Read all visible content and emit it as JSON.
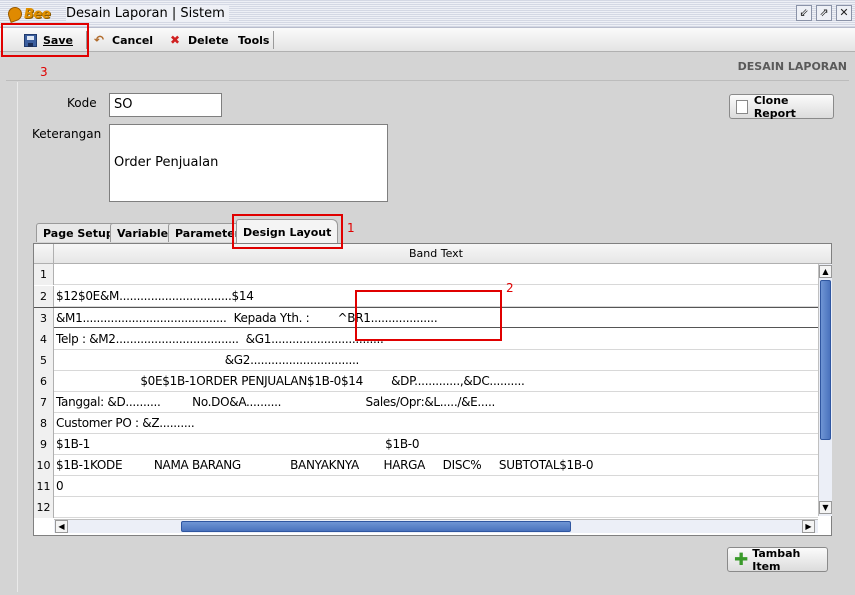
{
  "window": {
    "logo_text": "Bee",
    "title": "Desain Laporan | Sistem"
  },
  "toolbar": {
    "save_label": "Save",
    "cancel_label": "Cancel",
    "delete_label": "Delete",
    "tools_label": "Tools"
  },
  "section_title": "DESAIN LAPORAN",
  "form": {
    "kode_label": "Kode",
    "kode_value": "SO",
    "keterangan_label": "Keterangan",
    "keterangan_value": "Order Penjualan",
    "clone_report_label": "Clone Report"
  },
  "tabs": [
    "Page Setup",
    "Variable",
    "Parameter",
    "Design Layout"
  ],
  "active_tab": "Design Layout",
  "grid": {
    "header": "Band Text",
    "rows": [
      {
        "num": "1",
        "text": ""
      },
      {
        "num": "2",
        "text": "$12$0E&M................................$14"
      },
      {
        "num": "3",
        "text": "&M1.........................................  Kepada Yth. :        ^BR1..................."
      },
      {
        "num": "4",
        "text": "Telp : &M2...................................  &G1................................"
      },
      {
        "num": "5",
        "text": "                                                &G2..............................."
      },
      {
        "num": "6",
        "text": "                        $0E$1B-1ORDER PENJUALAN$1B-0$14        &DP.............,&DC.........."
      },
      {
        "num": "7",
        "text": "Tanggal: &D..........         No.DO&A..........                        Sales/Opr:&L...../&E....."
      },
      {
        "num": "8",
        "text": "Customer PO : &Z.........."
      },
      {
        "num": "9",
        "text": "$1B-1                                                                                    $1B-0"
      },
      {
        "num": "10",
        "text": "$1B-1KODE         NAMA BARANG              BANYAKNYA       HARGA     DISC%     SUBTOTAL$1B-0"
      },
      {
        "num": "11",
        "text": "0"
      },
      {
        "num": "12",
        "text": ""
      }
    ]
  },
  "tambah_item_label": "Tambah Item",
  "annotations": [
    "1",
    "2",
    "3"
  ],
  "colors": {
    "annotation": "#e00000",
    "scroll_thumb": "#4a72bd",
    "panel": "#d4d4d4"
  }
}
